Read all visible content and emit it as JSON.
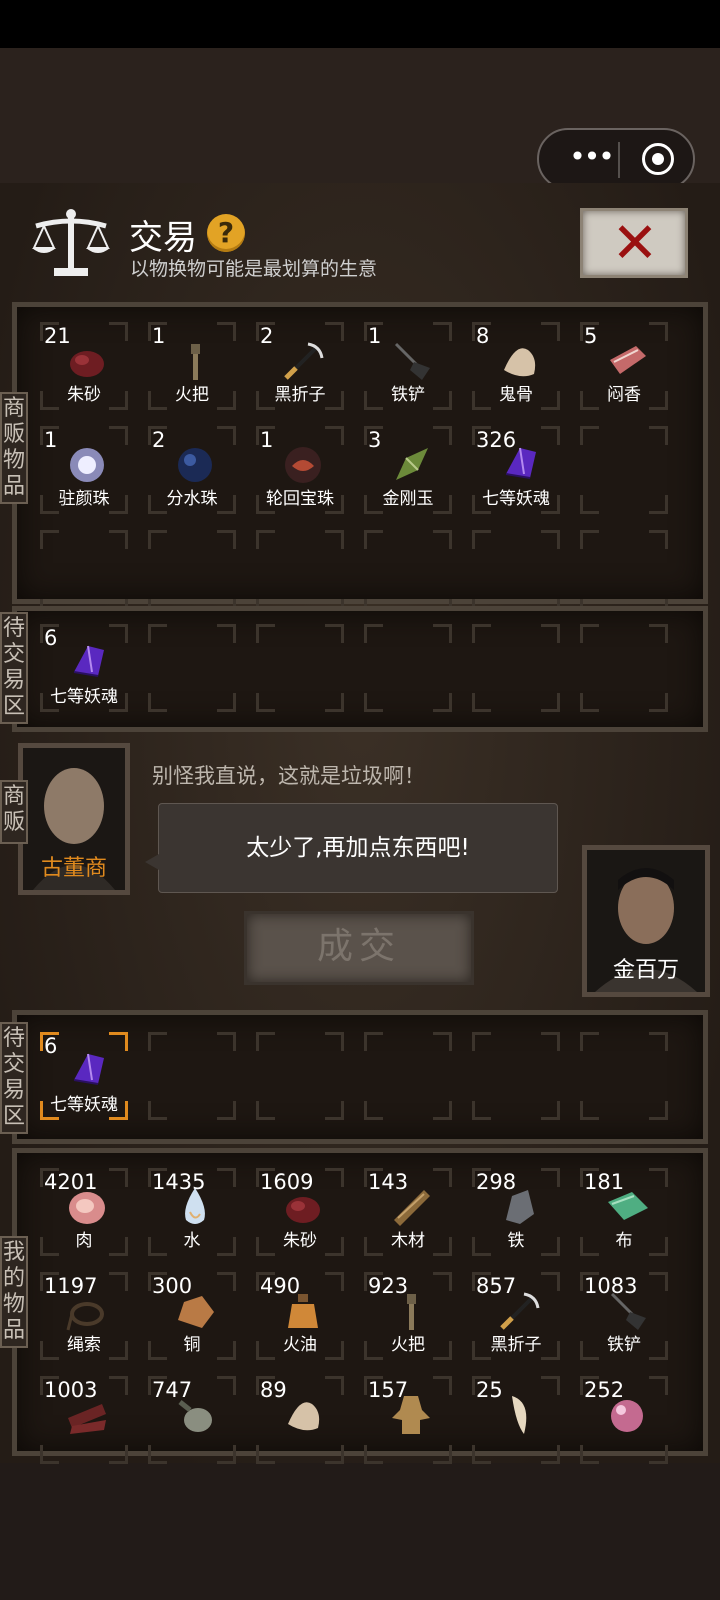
{
  "header": {
    "title": "交易",
    "help": "?",
    "subtitle": "以物换物可能是最划算的生意",
    "close": "✕"
  },
  "capsule": {
    "more": "•••"
  },
  "labels": {
    "merchant_items": "商贩物品",
    "pending": "待交易区",
    "merchant": "商贩",
    "my_items": "我的物品"
  },
  "merchant_items": [
    {
      "count": "21",
      "name": "朱砂",
      "icon": "cinnabar-icon"
    },
    {
      "count": "1",
      "name": "火把",
      "icon": "torch-icon"
    },
    {
      "count": "2",
      "name": "黑折子",
      "icon": "pickaxe-icon"
    },
    {
      "count": "1",
      "name": "铁铲",
      "icon": "shovel-icon"
    },
    {
      "count": "8",
      "name": "鬼骨",
      "icon": "bone-icon"
    },
    {
      "count": "5",
      "name": "闷香",
      "icon": "incense-icon"
    },
    {
      "count": "1",
      "name": "驻颜珠",
      "icon": "white-pearl-icon"
    },
    {
      "count": "2",
      "name": "分水珠",
      "icon": "blue-pearl-icon"
    },
    {
      "count": "1",
      "name": "轮回宝珠",
      "icon": "red-orb-icon"
    },
    {
      "count": "3",
      "name": "金刚玉",
      "icon": "green-jade-icon"
    },
    {
      "count": "326",
      "name": "七等妖魂",
      "icon": "purple-crystal-icon"
    }
  ],
  "merchant_pending": [
    {
      "count": "6",
      "name": "七等妖魂",
      "icon": "purple-crystal-icon"
    }
  ],
  "dialog": {
    "comment": "别怪我直说，这就是垃圾啊！",
    "message": "太少了,再加点东西吧!",
    "merchant_name": "古董商",
    "player_name": "金百万",
    "deal": "成交"
  },
  "my_pending": [
    {
      "count": "6",
      "name": "七等妖魂",
      "icon": "purple-crystal-icon"
    }
  ],
  "my_items": [
    {
      "count": "4201",
      "name": "肉",
      "icon": "meat-icon"
    },
    {
      "count": "1435",
      "name": "水",
      "icon": "water-drop-icon"
    },
    {
      "count": "1609",
      "name": "朱砂",
      "icon": "cinnabar-icon"
    },
    {
      "count": "143",
      "name": "木材",
      "icon": "wood-icon"
    },
    {
      "count": "298",
      "name": "铁",
      "icon": "iron-ore-icon"
    },
    {
      "count": "181",
      "name": "布",
      "icon": "cloth-icon"
    },
    {
      "count": "1197",
      "name": "绳索",
      "icon": "rope-icon"
    },
    {
      "count": "300",
      "name": "铜",
      "icon": "copper-ore-icon"
    },
    {
      "count": "490",
      "name": "火油",
      "icon": "oil-bottle-icon"
    },
    {
      "count": "923",
      "name": "火把",
      "icon": "torch-icon"
    },
    {
      "count": "857",
      "name": "黑折子",
      "icon": "pickaxe-icon"
    },
    {
      "count": "1083",
      "name": "铁铲",
      "icon": "shovel-icon"
    },
    {
      "count": "1003",
      "name": "",
      "icon": "jerky-icon"
    },
    {
      "count": "747",
      "name": "",
      "icon": "gourd-icon"
    },
    {
      "count": "89",
      "name": "",
      "icon": "bone-icon"
    },
    {
      "count": "157",
      "name": "",
      "icon": "pelt-icon"
    },
    {
      "count": "25",
      "name": "",
      "icon": "fang-icon"
    },
    {
      "count": "252",
      "name": "",
      "icon": "pink-pearl-icon"
    }
  ]
}
